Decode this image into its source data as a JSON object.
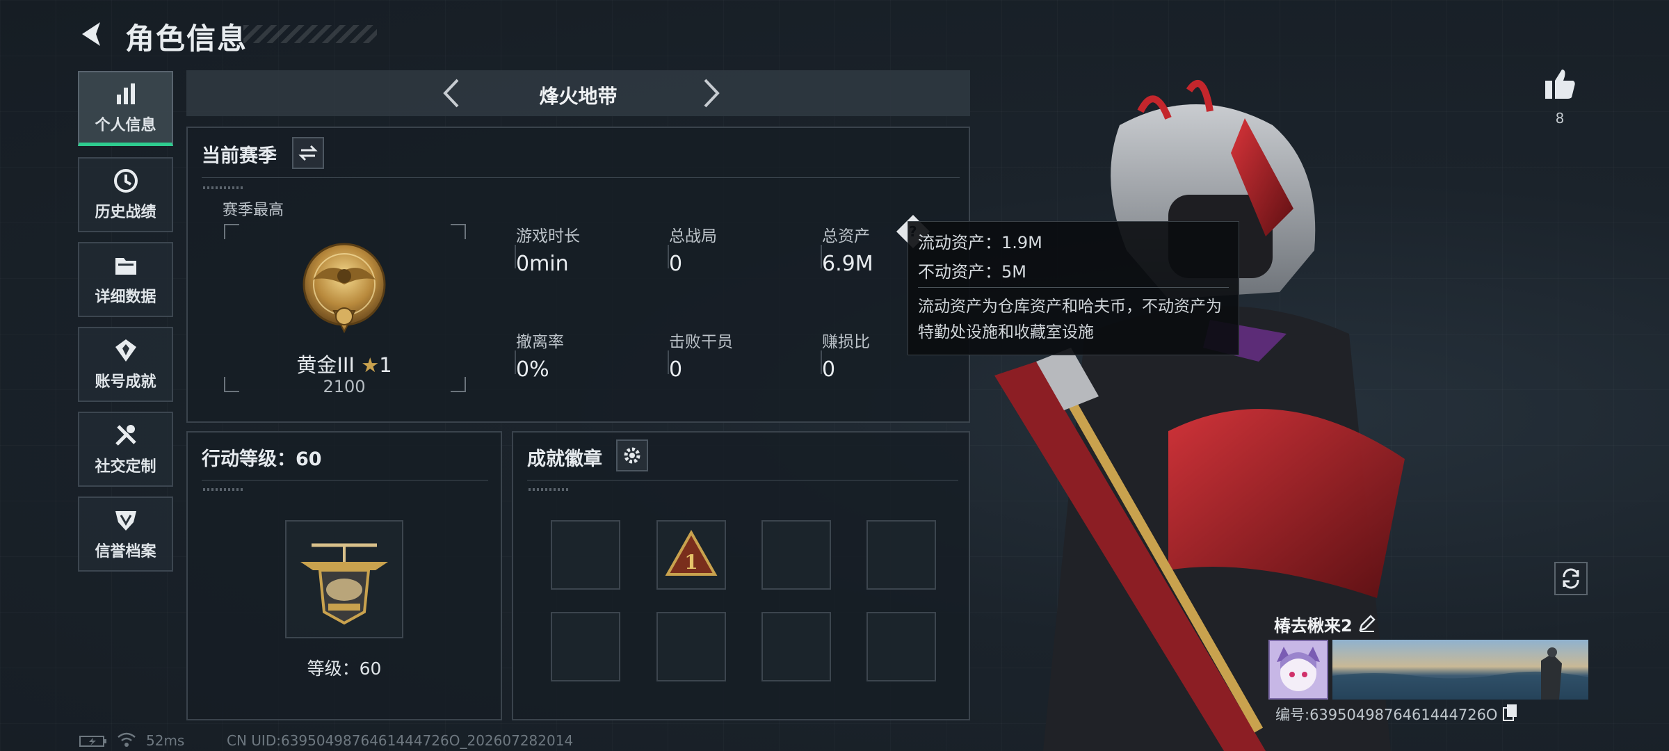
{
  "header": {
    "title": "角色信息"
  },
  "sidebar": {
    "items": [
      {
        "label": "个人信息",
        "icon": "bar-chart-icon",
        "active": true
      },
      {
        "label": "历史战绩",
        "icon": "history-clock-icon",
        "active": false
      },
      {
        "label": "详细数据",
        "icon": "folder-icon",
        "active": false
      },
      {
        "label": "账号成就",
        "icon": "achievement-icon",
        "active": false
      },
      {
        "label": "社交定制",
        "icon": "tools-icon",
        "active": false
      },
      {
        "label": "信誉档案",
        "icon": "reputation-icon",
        "active": false
      }
    ]
  },
  "mode": {
    "title": "烽火地带"
  },
  "season": {
    "title": "当前赛季",
    "best_label": "赛季最高",
    "rank_name": "黄金III",
    "rank_stars": "1",
    "rank_score": "2100",
    "stats": [
      {
        "label": "游戏时长",
        "value": "0min"
      },
      {
        "label": "总战局",
        "value": "0"
      },
      {
        "label": "总资产",
        "value": "6.9M"
      },
      {
        "label": "撤离率",
        "value": "0%"
      },
      {
        "label": "击败干员",
        "value": "0"
      },
      {
        "label": "赚损比",
        "value": "0"
      }
    ]
  },
  "tooltip": {
    "liquid": "流动资产：1.9M",
    "fixed": "不动资产：5M",
    "note": "流动资产为仓库资产和哈夫币，不动资产为特勤处设施和收藏室设施"
  },
  "action_level": {
    "title": "行动等级：60",
    "level_text": "等级：60"
  },
  "badges": {
    "title": "成就徽章",
    "slot_count": 8,
    "filled_slot_index": 1,
    "filled_glyph": "1"
  },
  "profile": {
    "likes": "8",
    "name": "椿去楸来2",
    "id_text": "编号:6395049876461444726O"
  },
  "status": {
    "ping": "52ms",
    "uid": "CN UID:6395049876461444726O_202607282014"
  },
  "colors": {
    "accent": "#2ecc8f",
    "gold": "#c9a24e",
    "panel_border": "#3a434c"
  }
}
